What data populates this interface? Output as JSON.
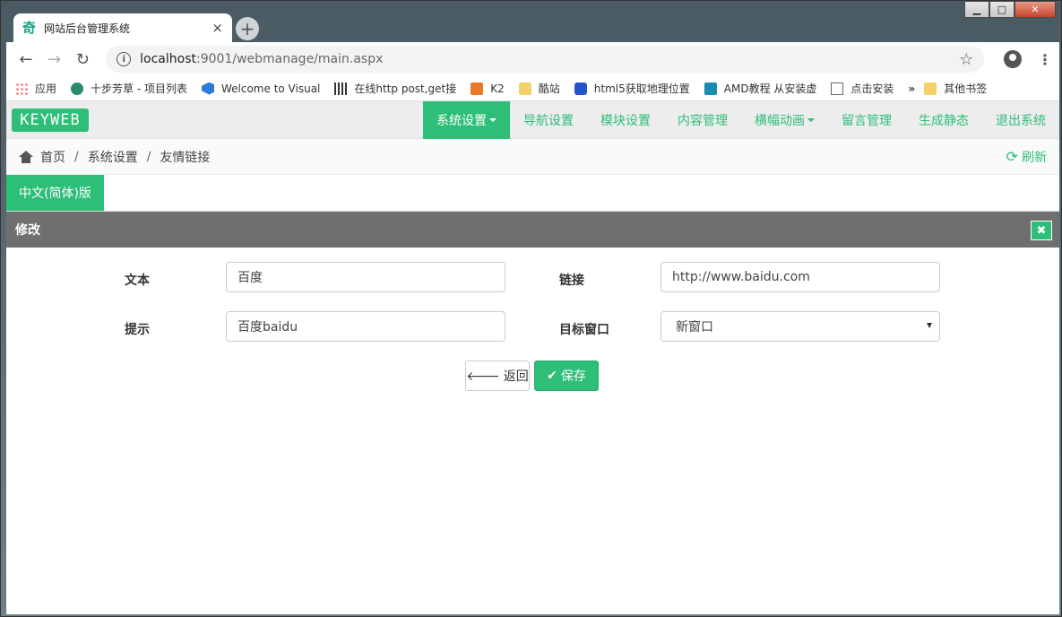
{
  "window": {
    "minimize": "▁",
    "maximize": "□",
    "close": "✕"
  },
  "tab": {
    "title": "网站后台管理系统",
    "close": "×",
    "new_tab": "+"
  },
  "browser": {
    "url_host": "localhost",
    "url_rest": ":9001/webmanage/main.aspx",
    "bookmarks": [
      {
        "label": "应用",
        "icon": "apps-icon"
      },
      {
        "label": "十步芳草 - 项目列表",
        "icon": "bug-icon"
      },
      {
        "label": "Welcome to Visual",
        "icon": "visual-studio-icon"
      },
      {
        "label": "在线http post,get接",
        "icon": "qr-icon"
      },
      {
        "label": "K2",
        "icon": "k2-icon"
      },
      {
        "label": "酷站",
        "icon": "folder-icon"
      },
      {
        "label": "html5获取地理位置",
        "icon": "paw-icon"
      },
      {
        "label": "AMD教程 从安装虚",
        "icon": "amd-icon"
      },
      {
        "label": "点击安装",
        "icon": "doc-icon"
      }
    ],
    "bookmarks_more": "»",
    "other_bookmarks": "其他书签"
  },
  "app": {
    "logo": "KEYWEB",
    "nav": [
      {
        "label": "系统设置",
        "dropdown": true,
        "active": true
      },
      {
        "label": "导航设置",
        "dropdown": false,
        "active": false
      },
      {
        "label": "模块设置",
        "dropdown": false,
        "active": false
      },
      {
        "label": "内容管理",
        "dropdown": false,
        "active": false
      },
      {
        "label": "横幅动画",
        "dropdown": true,
        "active": false
      },
      {
        "label": "留言管理",
        "dropdown": false,
        "active": false
      },
      {
        "label": "生成静态",
        "dropdown": false,
        "active": false
      },
      {
        "label": "退出系统",
        "dropdown": false,
        "active": false
      }
    ],
    "breadcrumb": {
      "home": "首页",
      "level1": "系统设置",
      "level2": "友情链接",
      "separator": "/",
      "refresh": "刷新"
    },
    "language_tab": "中文(简体)版",
    "panel_title": "修改",
    "form": {
      "text_label": "文本",
      "text_value": "百度",
      "link_label": "链接",
      "link_value": "http://www.baidu.com",
      "tip_label": "提示",
      "tip_value": "百度baidu",
      "target_label": "目标窗口",
      "target_value": "新窗口"
    },
    "buttons": {
      "back": "返回",
      "save": "保存"
    }
  },
  "colors": {
    "accent": "#2dbe78",
    "panel_header": "#6f6f6f"
  }
}
